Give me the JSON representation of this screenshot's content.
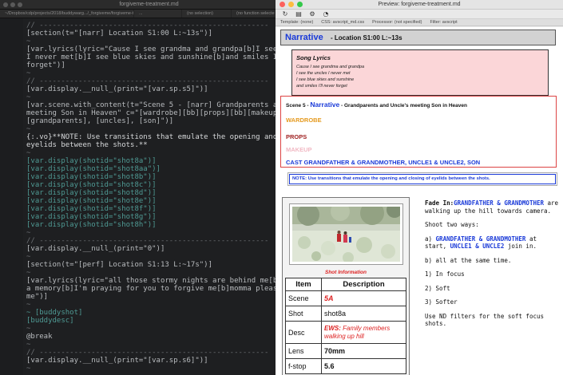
{
  "editor": {
    "title": "forgiveme-treatment.md",
    "tabs": [
      "~/Dropbox/cdp/projects/2018/buddywarg.../_forgiveme/forgiveme-treatment.md",
      "...",
      "(no selection)",
      "(no function selected)"
    ],
    "lines": [
      {
        "n": "",
        "t": "// -----------------------------------------------------"
      },
      {
        "n": "",
        "t": "[section(t=\"[narr] Location S1:00 L:~13s\")]"
      },
      {
        "n": "",
        "t": "~"
      },
      {
        "n": "",
        "t": "[var.lyrics(lyric=\"Cause I see grandma and grandpa[b]I see the uncles"
      },
      {
        "n": "",
        "t": "I never met[b]I see blue skies and sunshine[b]and smiles I'll never"
      },
      {
        "n": "",
        "t": "forget\")]"
      },
      {
        "n": "",
        "t": "~"
      },
      {
        "n": "",
        "t": "// -----------------------------------------------------"
      },
      {
        "n": "",
        "t": "[var.display.__null_(print=\"[var.sp.s5]\")]"
      },
      {
        "n": "",
        "t": "~"
      },
      {
        "n": "",
        "t": "[var.scene.with_content(t=\"Scene 5 - [narr] Grandparents and Uncle's"
      },
      {
        "n": "",
        "t": "meeting Son in Heaven\" c=\"[wardrobe][bb][props][bb][makeup][bb][cast]"
      },
      {
        "n": "",
        "t": "[grandparents], [uncles], [son]\")]"
      },
      {
        "n": "",
        "t": "~"
      },
      {
        "n": "",
        "t": "{:.vo}**NOTE: Use transitions that emulate the opening and closing of"
      },
      {
        "n": "",
        "t": "eyelids between the shots.**"
      },
      {
        "n": "",
        "t": "~"
      },
      {
        "n": "",
        "t": "[var.display(shotid=\"shot8a\")]"
      },
      {
        "n": "",
        "t": "[var.display(shotid=\"shot8aa\")]"
      },
      {
        "n": "",
        "t": "[var.display(shotid=\"shot8b\")]"
      },
      {
        "n": "",
        "t": "[var.display(shotid=\"shot8c\")]"
      },
      {
        "n": "",
        "t": "[var.display(shotid=\"shot8d\")]"
      },
      {
        "n": "",
        "t": "[var.display(shotid=\"shot8e\")]"
      },
      {
        "n": "",
        "t": "[var.display(shotid=\"shot8f\")]"
      },
      {
        "n": "",
        "t": "[var.display(shotid=\"shot8g\")]"
      },
      {
        "n": "",
        "t": "[var.display(shotid=\"shot8h\")]"
      },
      {
        "n": "",
        "t": "~"
      },
      {
        "n": "",
        "t": "// -----------------------------------------------------"
      },
      {
        "n": "",
        "t": "[var.display.__null_(print=\"0\")]"
      },
      {
        "n": "",
        "t": "~"
      },
      {
        "n": "",
        "t": "[section(t=\"[perf] Location S1:13 L:~17s\")]"
      },
      {
        "n": "",
        "t": "~"
      },
      {
        "n": "",
        "t": "[var.lyrics(lyric=\"all those stormy nights are behind me[b]they're all"
      },
      {
        "n": "",
        "t": "a memory[b]I'm praying for you to forgive me[b]momma please forgive"
      },
      {
        "n": "",
        "t": "me\")]"
      },
      {
        "n": "",
        "t": "~"
      },
      {
        "n": "",
        "t": "~ [buddyshot]"
      },
      {
        "n": "",
        "t": "[buddydesc]"
      },
      {
        "n": "",
        "t": "~"
      },
      {
        "n": "",
        "t": "@break"
      },
      {
        "n": "",
        "t": "~"
      },
      {
        "n": "",
        "t": "// -----------------------------------------------------"
      },
      {
        "n": "",
        "t": "[var.display.__null_(print=\"[var.sp.s6]\")]"
      },
      {
        "n": "",
        "t": "~"
      }
    ]
  },
  "preview": {
    "title": "Preview: forgiveme-treatment.md",
    "toolbar_icons": [
      "refresh-icon",
      "document-icon",
      "settings-icon",
      "gauge-icon"
    ],
    "status": {
      "template": "Template: (none)",
      "css": "CSS: avscript_md.css",
      "processor": "Processor: (not specified)",
      "filter": "Filter: avscript"
    },
    "narr1": {
      "word": "Narrative",
      "rest": "- Location S1:00 L:~13s"
    },
    "lyrics": {
      "heading": "Song Lyrics",
      "lines": [
        "Cause I see grandma and grandpa",
        "I see the uncles I never met",
        "I see blue skies and sunshine",
        "and smiles I'll never forget"
      ]
    },
    "scene": {
      "prefix": "Scene 5 -",
      "word": "Narrative",
      "suffix": "- Grandparents and Uncle's meeting Son in Heaven",
      "wardrobe": "WARDROBE",
      "props": "PROPS",
      "makeup": "MAKEUP",
      "cast": "CAST GRANDFATHER & GRANDMOTHER, UNCLE1 & UNCLE2, SON"
    },
    "note": "NOTE: Use transitions that emulate the opening and closing of eyelids between the shots.",
    "shot": {
      "info_title": "Shot Information",
      "head_item": "Item",
      "head_desc": "Description",
      "rows": [
        {
          "k": "Scene",
          "v": "5A"
        },
        {
          "k": "Shot",
          "v": "shot8a"
        },
        {
          "k": "Desc",
          "v_prefix": "EWS:",
          "v": "Family members walking up hill"
        },
        {
          "k": "Lens",
          "v": "70mm"
        },
        {
          "k": "f-stop",
          "v": "5.6"
        }
      ]
    },
    "fade": {
      "p1_pre": "Fade In:",
      "p1_bold": "GRANDFATHER & GRANDMOTHER",
      "p1_post": " are walking up the hill towards camera.",
      "p2": "Shoot two ways:",
      "p3_pre": "a) ",
      "p3_b1": "GRANDFATHER & GRANDMOTHER",
      "p3_mid": " at start, ",
      "p3_b2": "UNCLE1 & UNCLE2",
      "p3_post": " join in.",
      "p4": "b) all at the same time.",
      "p5": "1) In focus",
      "p6": "2) Soft",
      "p7": "3) Softer",
      "p8": "Use ND filters for the soft focus shots."
    }
  },
  "colors": {
    "accent_blue": "#1a3ad8",
    "red": "#dd2222",
    "lyrics_bg": "#fbd6d8",
    "editor_bg": "#1e1f21"
  }
}
